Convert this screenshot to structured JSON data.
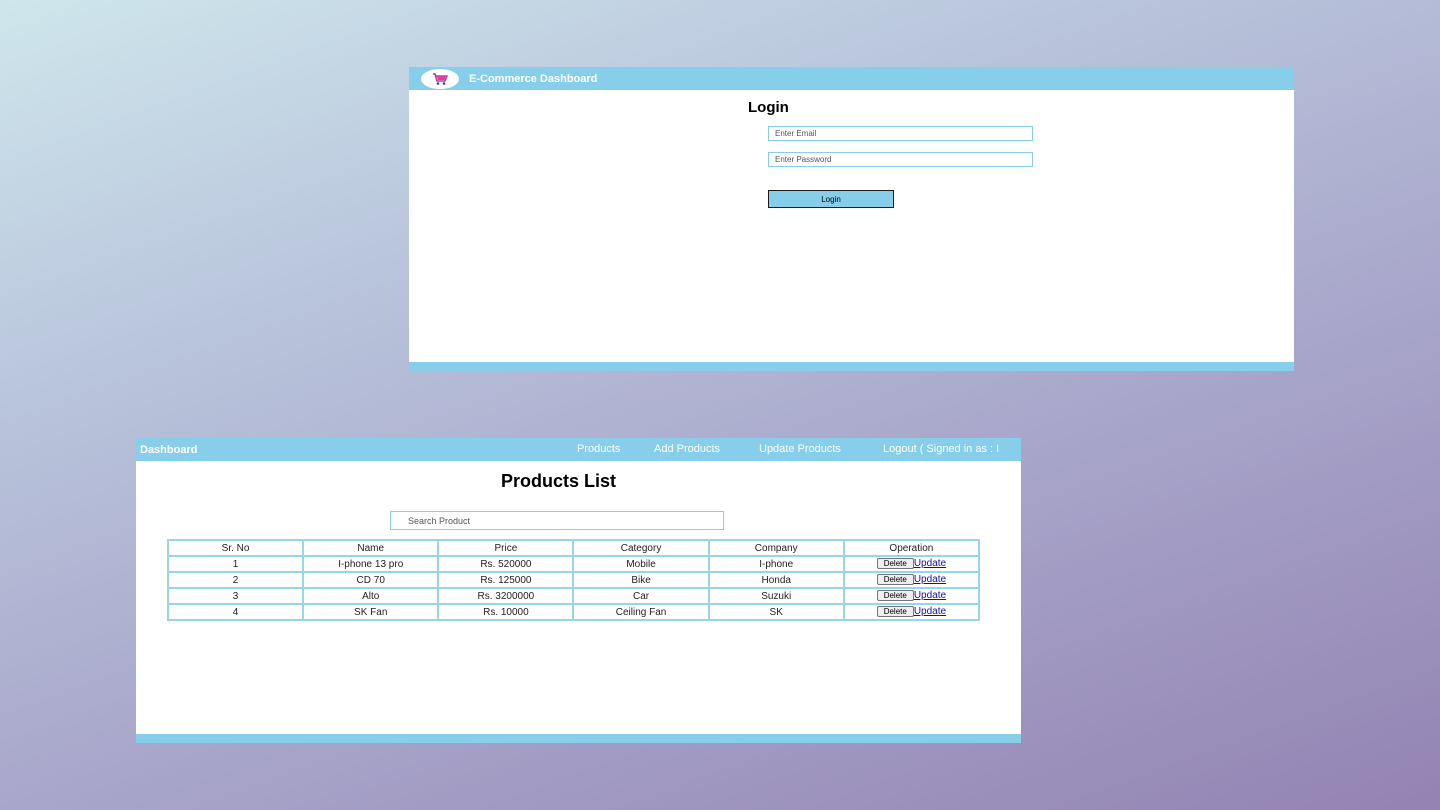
{
  "colors": {
    "accent": "#87ceeb",
    "link": "#1a0dab"
  },
  "login": {
    "brand": "E-Commerce Dashboard",
    "logo_icon": "shopping-cart-icon",
    "title": "Login",
    "email_placeholder": "Enter Email",
    "password_placeholder": "Enter Password",
    "button_label": "Login"
  },
  "dashboard": {
    "brand": "Dashboard",
    "nav": {
      "products": "Products",
      "add_products": "Add Products",
      "update_products": "Update Products",
      "logout": "Logout ( Signed in as : I"
    },
    "title": "Products List",
    "search_placeholder": "Search Product",
    "table": {
      "headers": [
        "Sr. No",
        "Name",
        "Price",
        "Category",
        "Company",
        "Operation"
      ],
      "rows": [
        [
          "1",
          "I-phone 13 pro",
          "Rs. 520000",
          "Mobile",
          "I-phone"
        ],
        [
          "2",
          "CD 70",
          "Rs. 125000",
          "Bike",
          "Honda"
        ],
        [
          "3",
          "Alto",
          "Rs. 3200000",
          "Car",
          "Suzuki"
        ],
        [
          "4",
          "SK Fan",
          "Rs. 10000",
          "Ceiling Fan",
          "SK"
        ]
      ],
      "delete_label": "Delete",
      "update_label": "Update"
    }
  }
}
